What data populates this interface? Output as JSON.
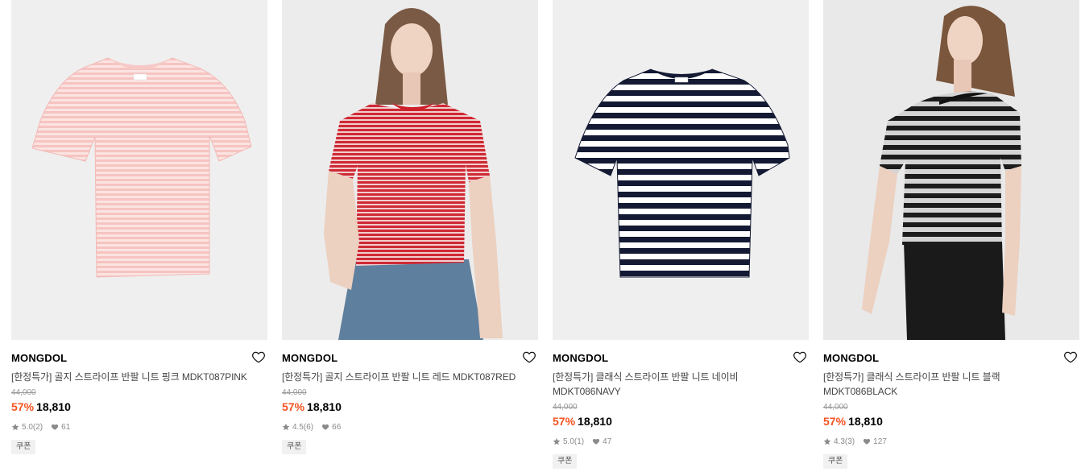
{
  "products": [
    {
      "brand": "MONGDOL",
      "name": "[한정특가] 골지 스트라이프 반팔 니트 핑크 MDKT087PINK",
      "original_price": "44,000",
      "discount": "57%",
      "price": "18,810",
      "rating": "5.0",
      "reviews": "(2)",
      "likes": "61",
      "badge": "쿠폰",
      "image": "pink-striped-knit-tshirt",
      "stripe_colors": [
        "#f7c9c6",
        "#fbe4e1"
      ]
    },
    {
      "brand": "MONGDOL",
      "name": "[한정특가] 골지 스트라이프 반팔 니트 레드 MDKT087RED",
      "original_price": "44,000",
      "discount": "57%",
      "price": "18,810",
      "rating": "4.5",
      "reviews": "(6)",
      "likes": "66",
      "badge": "쿠폰",
      "image": "model-wearing-red-striped-knit",
      "stripe_colors": [
        "#cf2a35",
        "#f2c9c9"
      ]
    },
    {
      "brand": "MONGDOL",
      "name": "[한정특가] 클래식 스트라이프 반팔 니트 네이비 MDKT086NAVY",
      "original_price": "44,000",
      "discount": "57%",
      "price": "18,810",
      "rating": "5.0",
      "reviews": "(1)",
      "likes": "47",
      "badge": "쿠폰",
      "image": "navy-striped-knit-tshirt",
      "stripe_colors": [
        "#141a33",
        "#ffffff"
      ]
    },
    {
      "brand": "MONGDOL",
      "name": "[한정특가] 클래식 스트라이프 반팔 니트 블랙 MDKT086BLACK",
      "original_price": "44,000",
      "discount": "57%",
      "price": "18,810",
      "rating": "4.3",
      "reviews": "(3)",
      "likes": "127",
      "badge": "쿠폰",
      "image": "model-wearing-black-striped-knit",
      "stripe_colors": [
        "#1c1c1c",
        "#cfcfcf"
      ]
    }
  ],
  "colors": {
    "discount": "#f5521f",
    "image_bg": "#efefef",
    "meta": "#8a8a8a"
  }
}
